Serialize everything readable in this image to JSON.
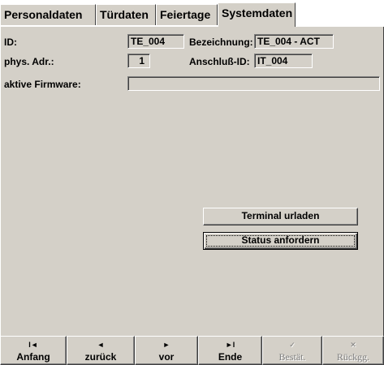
{
  "tabs": [
    {
      "label": "Personaldaten",
      "active": false
    },
    {
      "label": "Türdaten",
      "active": false
    },
    {
      "label": "Feiertage",
      "active": false
    },
    {
      "label": "Systemdaten",
      "active": true
    }
  ],
  "form": {
    "id_label": "ID:",
    "id_value": "TE_004",
    "bezeichnung_label": "Bezeichnung:",
    "bezeichnung_value": "TE_004 - ACT",
    "phys_adr_label": "phys. Adr.:",
    "phys_adr_value": "1",
    "anschluss_label": "Anschluß-ID:",
    "anschluss_value": "IT_004",
    "firmware_label": "aktive Firmware:",
    "firmware_value": ""
  },
  "actions": {
    "terminal_urladen": "Terminal urladen",
    "status_anfordern": "Status anfordern"
  },
  "nav": {
    "anfang": {
      "icon": "I◄",
      "label": "Anfang"
    },
    "zurueck": {
      "icon": "◄",
      "label": "zurück"
    },
    "vor": {
      "icon": "►",
      "label": "vor"
    },
    "ende": {
      "icon": "►I",
      "label": "Ende"
    },
    "bestaet": {
      "icon": "✓",
      "label": "Bestät."
    },
    "rueckgg": {
      "icon": "✕",
      "label": "Rückgg."
    }
  },
  "colors": {
    "panel": "#d4d0c8",
    "shadow": "#808080",
    "disabled_text": "#808080"
  }
}
